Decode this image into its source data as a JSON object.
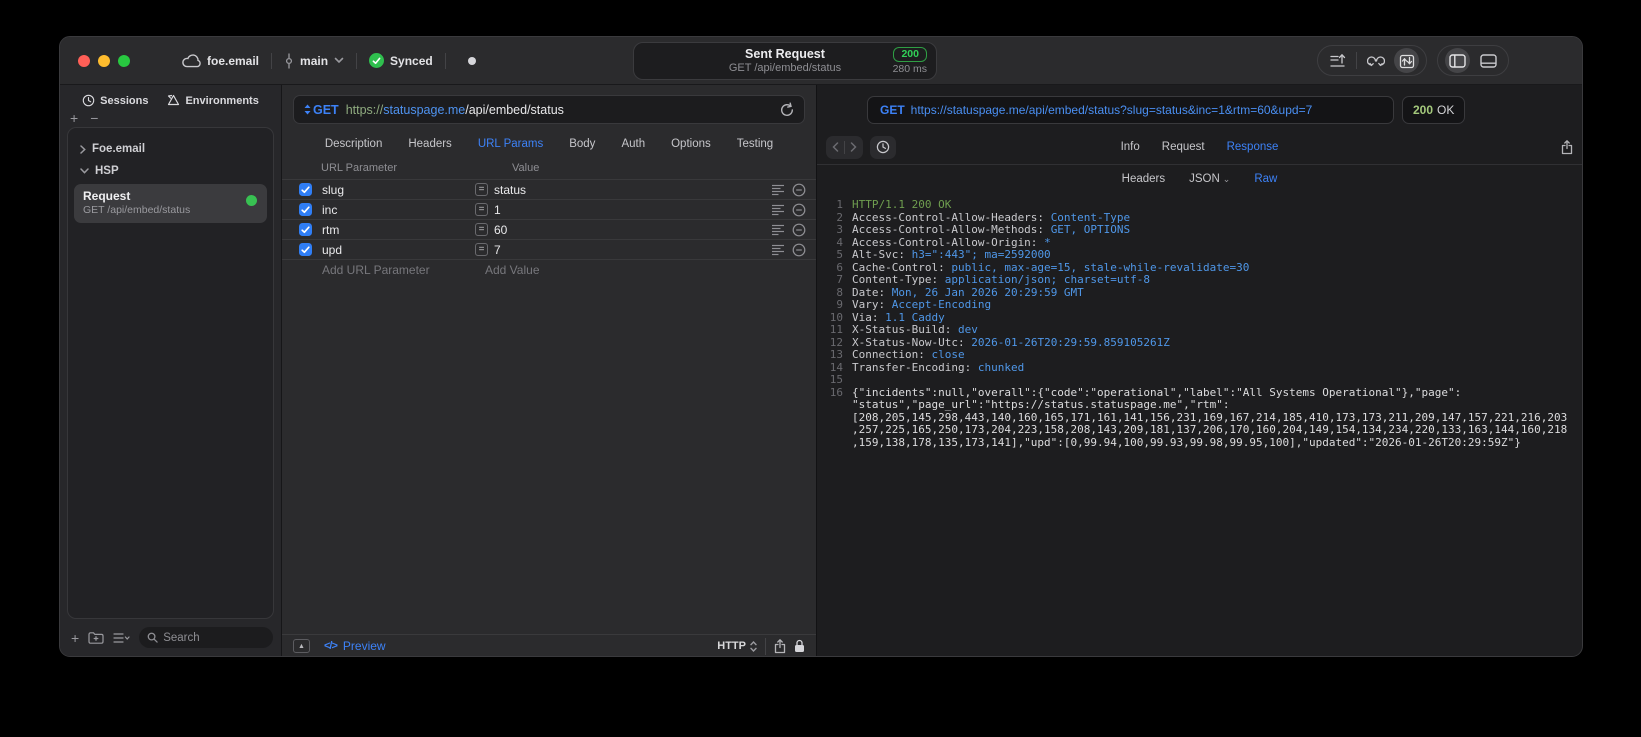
{
  "titlebar": {
    "project_name": "foe.email",
    "branch_name": "main",
    "sync_label": "Synced",
    "request_summary": {
      "title": "Sent Request",
      "subtitle": "GET /api/embed/status",
      "status_code": "200",
      "duration": "280 ms"
    }
  },
  "sidebar": {
    "tabs": [
      {
        "label": "Sessions"
      },
      {
        "label": "Environments"
      }
    ],
    "add_label": "+",
    "remove_label": "−",
    "tree": [
      {
        "label": "Foe.email",
        "expanded": false
      },
      {
        "label": "HSP",
        "expanded": true
      }
    ],
    "request_item": {
      "title": "Request",
      "subtitle": "GET /api/embed/status"
    },
    "search_placeholder": "Search"
  },
  "request_editor": {
    "method": "GET",
    "url": {
      "scheme": "https://",
      "host": "statuspage.me",
      "path": "/api/embed/status"
    },
    "tabs": [
      "Description",
      "Headers",
      "URL Params",
      "Body",
      "Auth",
      "Options",
      "Testing"
    ],
    "active_tab": "URL Params",
    "params": {
      "columns": [
        "URL Parameter",
        "Value"
      ],
      "rows": [
        {
          "enabled": true,
          "name": "slug",
          "value": "status"
        },
        {
          "enabled": true,
          "name": "inc",
          "value": "1"
        },
        {
          "enabled": true,
          "name": "rtm",
          "value": "60"
        },
        {
          "enabled": true,
          "name": "upd",
          "value": "7"
        }
      ],
      "add_name_placeholder": "Add URL Parameter",
      "add_value_placeholder": "Add Value"
    },
    "footer": {
      "code_glyph": "</>",
      "preview_label": "Preview",
      "format_selector": "HTTP"
    }
  },
  "response_viewer": {
    "request_line": {
      "method": "GET",
      "url": "https://statuspage.me/api/embed/status?slug=status&inc=1&rtm=60&upd=7"
    },
    "status_badge": {
      "code": "200",
      "text": "OK"
    },
    "tabs": [
      "Info",
      "Request",
      "Response"
    ],
    "active_tab": "Response",
    "subtabs": [
      "Headers",
      "JSON",
      "Raw"
    ],
    "active_subtab": "Raw",
    "raw": {
      "status_line": "HTTP/1.1 200 OK",
      "headers": [
        {
          "name": "Access-Control-Allow-Headers",
          "value": "Content-Type"
        },
        {
          "name": "Access-Control-Allow-Methods",
          "value": "GET, OPTIONS"
        },
        {
          "name": "Access-Control-Allow-Origin",
          "value": "*"
        },
        {
          "name": "Alt-Svc",
          "value": "h3=\":443\"; ma=2592000"
        },
        {
          "name": "Cache-Control",
          "value": "public, max-age=15, stale-while-revalidate=30"
        },
        {
          "name": "Content-Type",
          "value": "application/json; charset=utf-8"
        },
        {
          "name": "Date",
          "value": "Mon, 26 Jan 2026 20:29:59 GMT"
        },
        {
          "name": "Vary",
          "value": "Accept-Encoding"
        },
        {
          "name": "Via",
          "value": "1.1 Caddy"
        },
        {
          "name": "X-Status-Build",
          "value": "dev"
        },
        {
          "name": "X-Status-Now-Utc",
          "value": "2026-01-26T20:29:59.859105261Z"
        },
        {
          "name": "Connection",
          "value": "close"
        },
        {
          "name": "Transfer-Encoding",
          "value": "chunked"
        }
      ],
      "body": "{\"incidents\":null,\"overall\":{\"code\":\"operational\",\"label\":\"All Systems Operational\"},\"page\":\"status\",\"page_url\":\"https://status.statuspage.me\",\"rtm\":[208,205,145,298,443,140,160,165,171,161,141,156,231,169,167,214,185,410,173,173,211,209,147,157,221,216,203,257,225,165,250,173,204,223,158,208,143,209,181,137,206,170,160,204,149,154,134,234,220,133,163,144,160,218,159,138,178,135,173,141],\"upd\":[0,99.94,100,99.93,99.98,99.95,100],\"updated\":\"2026-01-26T20:29:59Z\"}"
    }
  },
  "colors": {
    "accent_blue": "#3d82f7",
    "success_green": "#32d74b",
    "header_value_blue": "#4f97e8",
    "status_line_green": "#6f9e4f",
    "checkbox_blue": "#2f7ef6",
    "badge_green_border": "#2f9e44",
    "status_code_green": "#a4c97c"
  }
}
